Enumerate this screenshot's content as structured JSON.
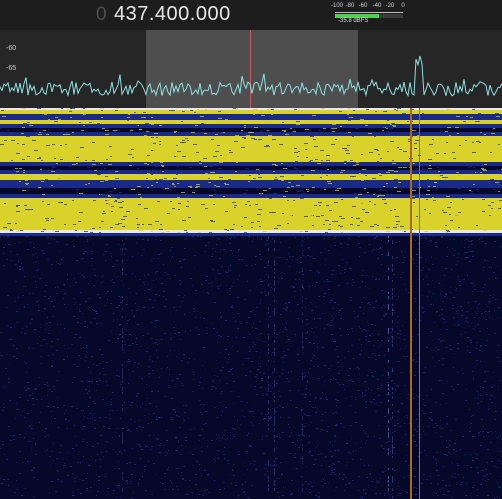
{
  "header": {
    "frequency_lead": "0",
    "frequency": "437.400.000"
  },
  "meter": {
    "ticks": [
      "-100",
      "-80",
      "-60",
      "-40",
      "-20",
      "0"
    ],
    "readout": "-35.8 dBFS",
    "level_dbfs": -35.8,
    "fill_color": "#4ed14e"
  },
  "spectrum": {
    "db_labels": [
      "-60",
      "-65"
    ],
    "trace_color": "#8fe0e0",
    "passband_color": "#a0a0a0",
    "center_line_color": "#c65a5a"
  },
  "waterfall": {
    "colors": {
      "background": "#06082a",
      "noise": "#1a2a8a",
      "band": "#d8d22a",
      "edge": "#e8e8e8"
    },
    "signal_colors": [
      "#a86a1c",
      "#c75a10"
    ]
  }
}
